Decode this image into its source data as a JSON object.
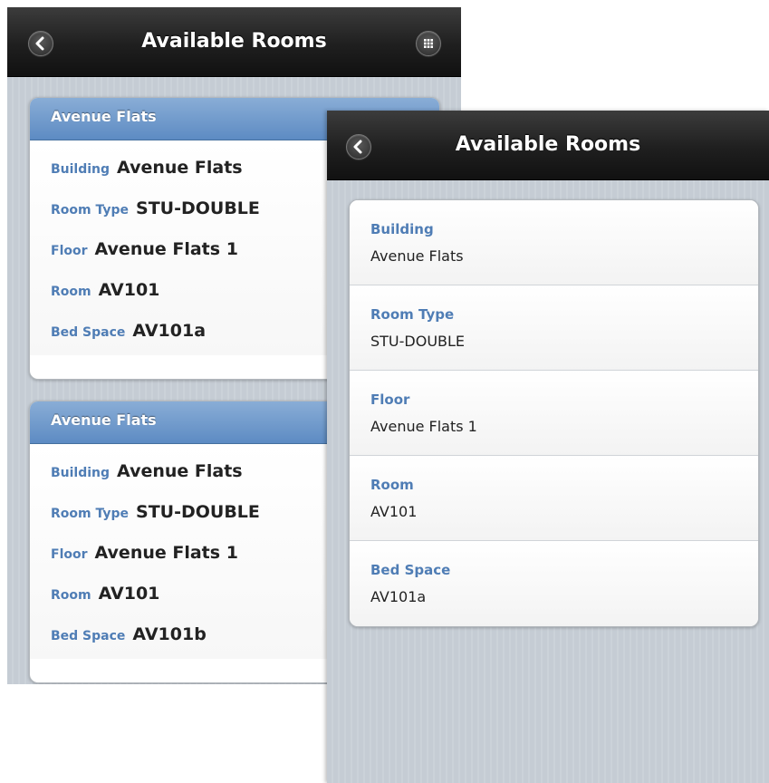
{
  "left_screen": {
    "title": "Available Rooms",
    "back_icon": "chevron-left-icon",
    "menu_icon": "grid-icon",
    "cards": [
      {
        "header": "Avenue Flats",
        "fields": [
          {
            "label": "Building",
            "value": "Avenue Flats"
          },
          {
            "label": "Room Type",
            "value": "STU-DOUBLE"
          },
          {
            "label": "Floor",
            "value": "Avenue Flats 1"
          },
          {
            "label": "Room",
            "value": "AV101"
          },
          {
            "label": "Bed Space",
            "value": "AV101a"
          }
        ]
      },
      {
        "header": "Avenue Flats",
        "fields": [
          {
            "label": "Building",
            "value": "Avenue Flats"
          },
          {
            "label": "Room Type",
            "value": "STU-DOUBLE"
          },
          {
            "label": "Floor",
            "value": "Avenue Flats 1"
          },
          {
            "label": "Room",
            "value": "AV101"
          },
          {
            "label": "Bed Space",
            "value": "AV101b"
          }
        ]
      }
    ]
  },
  "right_screen": {
    "title": "Available Rooms",
    "back_icon": "chevron-left-icon",
    "fields": [
      {
        "label": "Building",
        "value": "Avenue Flats"
      },
      {
        "label": "Room Type",
        "value": "STU-DOUBLE"
      },
      {
        "label": "Floor",
        "value": "Avenue Flats 1"
      },
      {
        "label": "Room",
        "value": "AV101"
      },
      {
        "label": "Bed Space",
        "value": "AV101a"
      }
    ]
  },
  "colors": {
    "header_blue": "#5d8bc3",
    "label_blue": "#4f7db5",
    "toolbar_black": "#1f1f1f",
    "background_stripes": "#c5ccd4"
  }
}
